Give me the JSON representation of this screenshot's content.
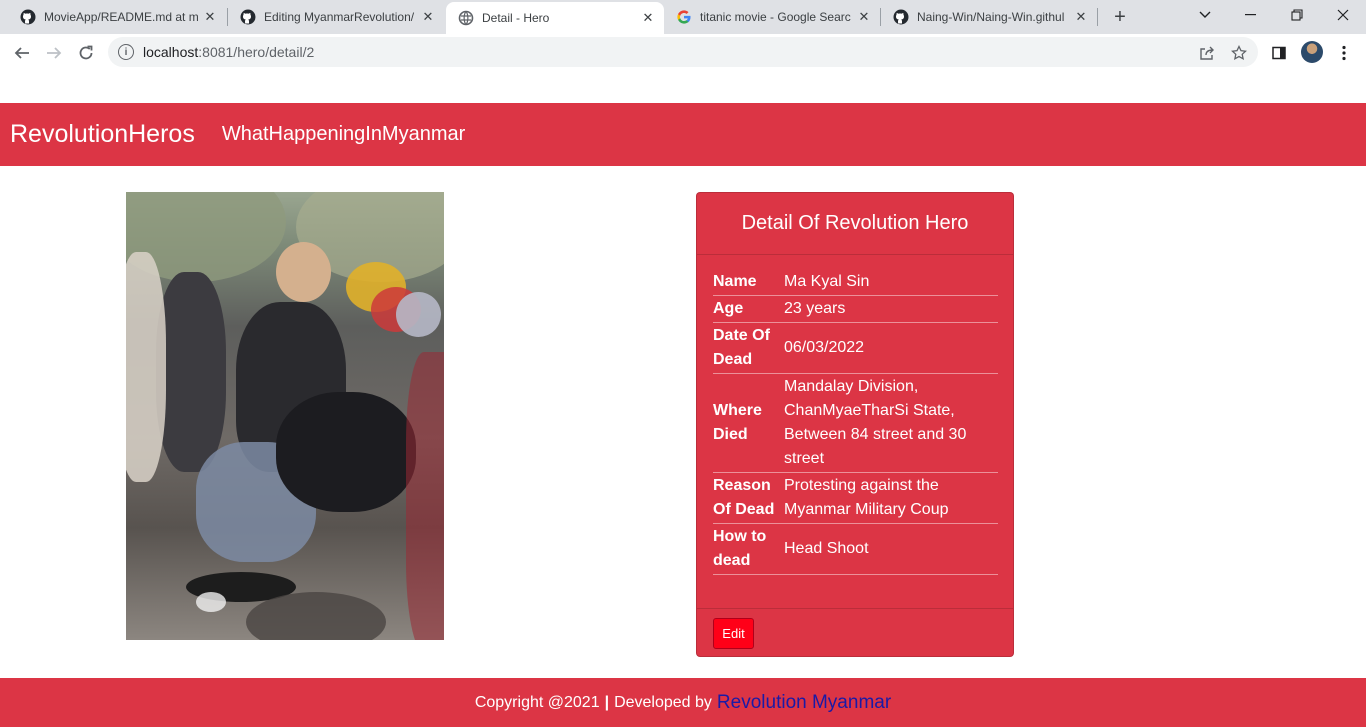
{
  "browser": {
    "tabs": [
      {
        "title": "MovieApp/README.md at m",
        "icon": "github-icon"
      },
      {
        "title": "Editing MyanmarRevolution/",
        "icon": "github-icon"
      },
      {
        "title": "Detail - Hero",
        "icon": "globe-icon"
      },
      {
        "title": "titanic movie - Google Searc",
        "icon": "google-icon"
      },
      {
        "title": "Naing-Win/Naing-Win.githul",
        "icon": "github-icon"
      }
    ],
    "url_host": "localhost",
    "url_rest": ":8081/hero/detail/2"
  },
  "navbar": {
    "brand": "RevolutionHeros",
    "link": "WhatHappeningInMyanmar"
  },
  "card": {
    "title": "Detail Of Revolution Hero",
    "rows": [
      {
        "label": "Name",
        "value": "Ma Kyal Sin"
      },
      {
        "label": "Age",
        "value": "23 years"
      },
      {
        "label": "Date Of Dead",
        "value": "06/03/2022"
      },
      {
        "label": "Where Died",
        "value": "Mandalay Division, ChanMyaeTharSi State, Between 84 street and 30 street"
      },
      {
        "label": "Reason Of Dead",
        "value": "Protesting against the Myanmar Military Coup"
      },
      {
        "label": "How to dead",
        "value": "Head Shoot"
      }
    ],
    "edit_label": "Edit"
  },
  "footer": {
    "text": "Copyright @2021",
    "separator": "|",
    "developed_by": "Developed by",
    "link": "Revolution Myanmar"
  },
  "colors": {
    "primary": "#dc3545",
    "edit_button": "#ff0018",
    "footer_link": "#1a1aa6"
  }
}
